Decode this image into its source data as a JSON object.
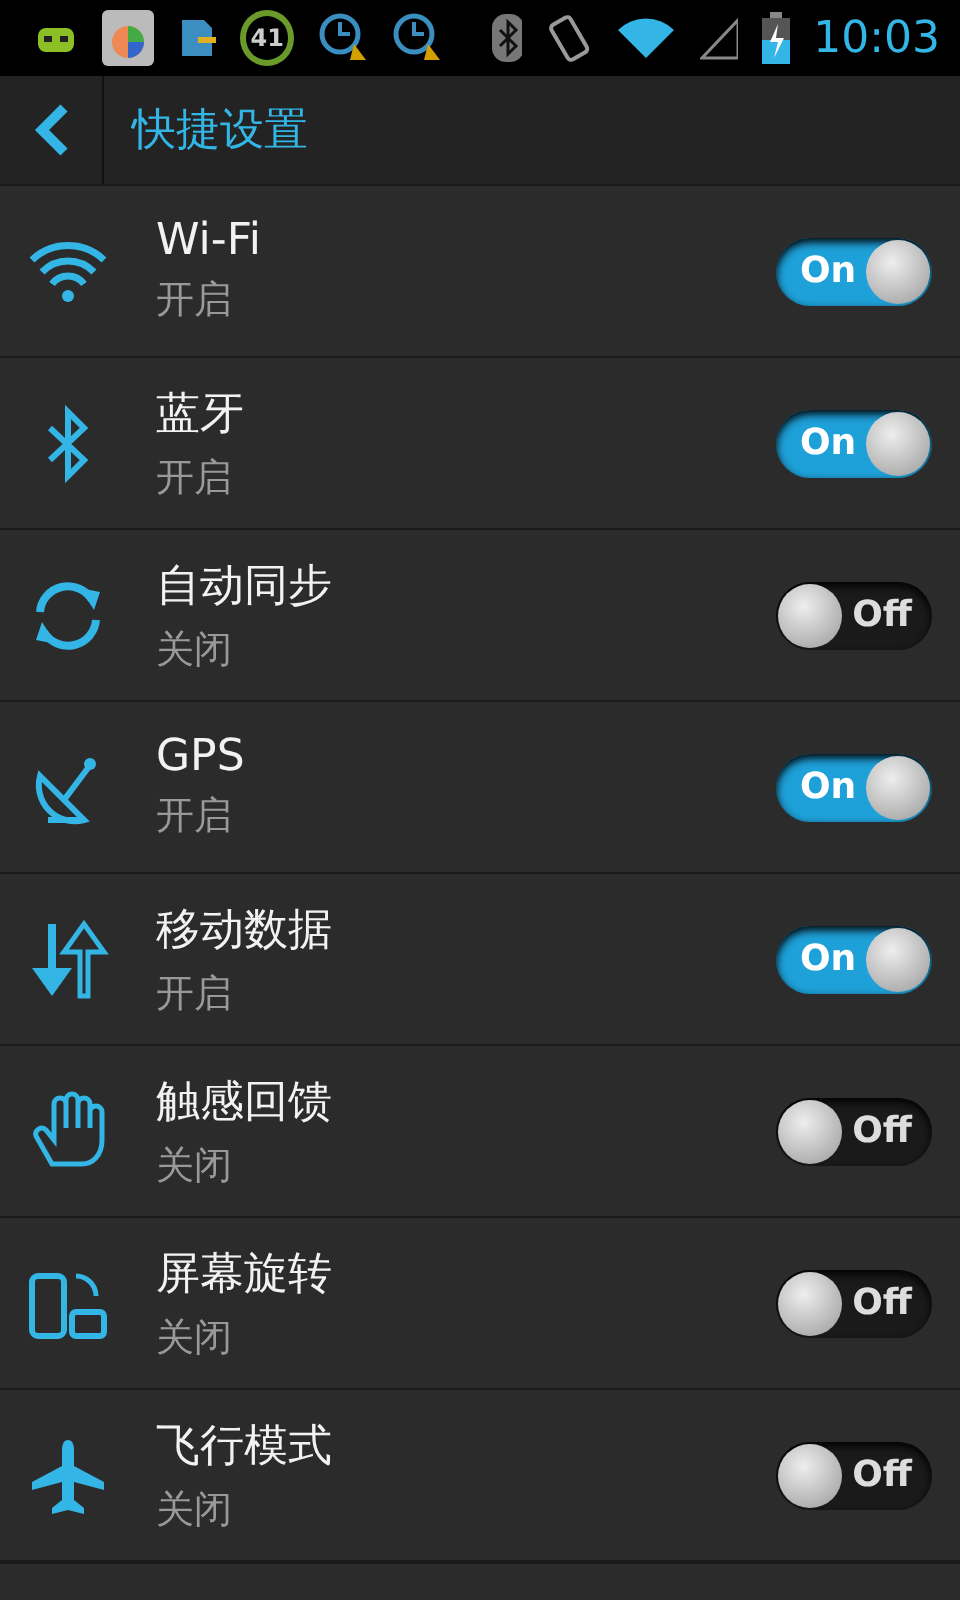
{
  "status_bar": {
    "badge": "41",
    "time": "10:03"
  },
  "title_bar": {
    "title": "快捷设置"
  },
  "settings": [
    {
      "kind": "wifi",
      "title": "Wi-Fi",
      "status": "开启",
      "on": true,
      "toggle_label": "On"
    },
    {
      "kind": "bluetooth",
      "title": "蓝牙",
      "status": "开启",
      "on": true,
      "toggle_label": "On"
    },
    {
      "kind": "sync",
      "title": "自动同步",
      "status": "关闭",
      "on": false,
      "toggle_label": "Off"
    },
    {
      "kind": "gps",
      "title": "GPS",
      "status": "开启",
      "on": true,
      "toggle_label": "On"
    },
    {
      "kind": "data",
      "title": "移动数据",
      "status": "开启",
      "on": true,
      "toggle_label": "On"
    },
    {
      "kind": "haptic",
      "title": "触感回馈",
      "status": "关闭",
      "on": false,
      "toggle_label": "Off"
    },
    {
      "kind": "rotate",
      "title": "屏幕旋转",
      "status": "关闭",
      "on": false,
      "toggle_label": "Off"
    },
    {
      "kind": "airplane",
      "title": "飞行模式",
      "status": "关闭",
      "on": false,
      "toggle_label": "Off"
    }
  ]
}
